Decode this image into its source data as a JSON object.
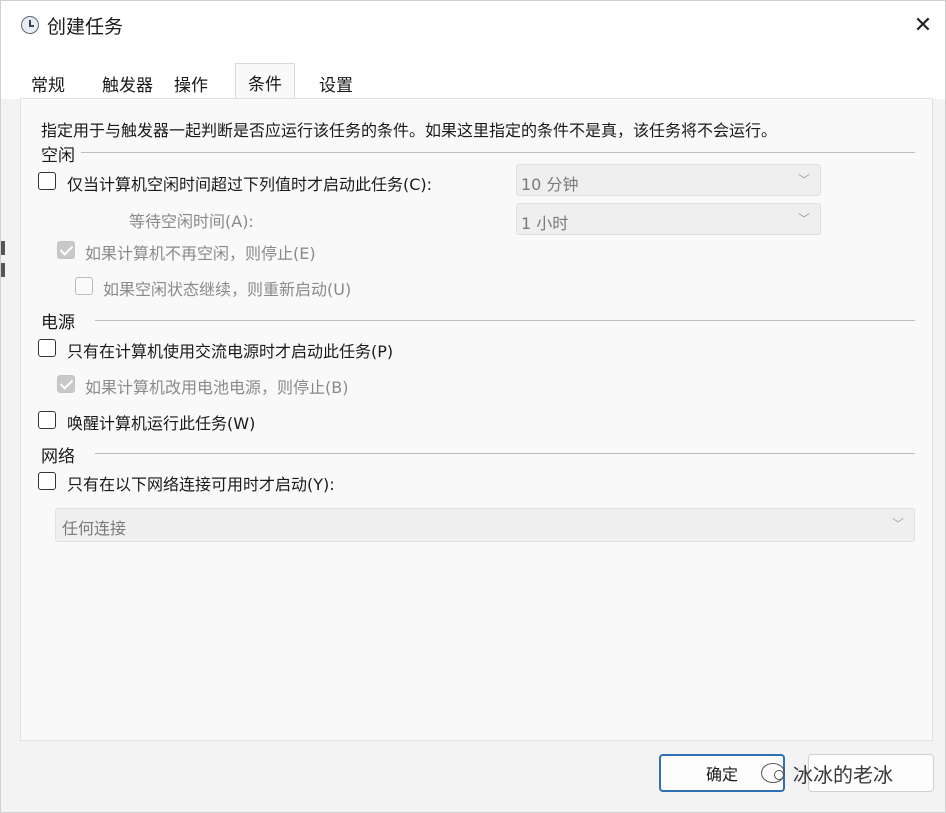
{
  "window": {
    "title": "创建任务",
    "close_glyph": "✕"
  },
  "tabs": [
    {
      "label": "常规",
      "active": false
    },
    {
      "label": "触发器",
      "active": false
    },
    {
      "label": "操作",
      "active": false
    },
    {
      "label": "条件",
      "active": true
    },
    {
      "label": "设置",
      "active": false
    }
  ],
  "conditions": {
    "description": "指定用于与触发器一起判断是否应运行该任务的条件。如果这里指定的条件不是真，该任务将不会运行。",
    "idle": {
      "group_label": "空闲",
      "start_if_idle": {
        "label": "仅当计算机空闲时间超过下列值时才启动此任务(C):",
        "checked": false
      },
      "idle_duration": {
        "value": "10 分钟"
      },
      "wait_label": "等待空闲时间(A):",
      "wait_duration": {
        "value": "1 小时"
      },
      "stop_if_not_idle": {
        "label": "如果计算机不再空闲，则停止(E)",
        "checked": true
      },
      "restart_if_idle": {
        "label": "如果空闲状态继续，则重新启动(U)",
        "checked": false
      }
    },
    "power": {
      "group_label": "电源",
      "ac_only": {
        "label": "只有在计算机使用交流电源时才启动此任务(P)",
        "checked": false
      },
      "stop_on_battery": {
        "label": "如果计算机改用电池电源，则停止(B)",
        "checked": true
      },
      "wake": {
        "label": "唤醒计算机运行此任务(W)",
        "checked": false
      }
    },
    "network": {
      "group_label": "网络",
      "network_only": {
        "label": "只有在以下网络连接可用时才启动(Y):",
        "checked": false
      },
      "connection": {
        "value": "任何连接"
      }
    }
  },
  "buttons": {
    "ok": "确定"
  },
  "watermark": {
    "text": "冰冰的老冰"
  },
  "colors": {
    "accent_border": "#2f6fb3",
    "panel_bg": "#f9f9f9",
    "window_bg": "#f3f3f3"
  }
}
